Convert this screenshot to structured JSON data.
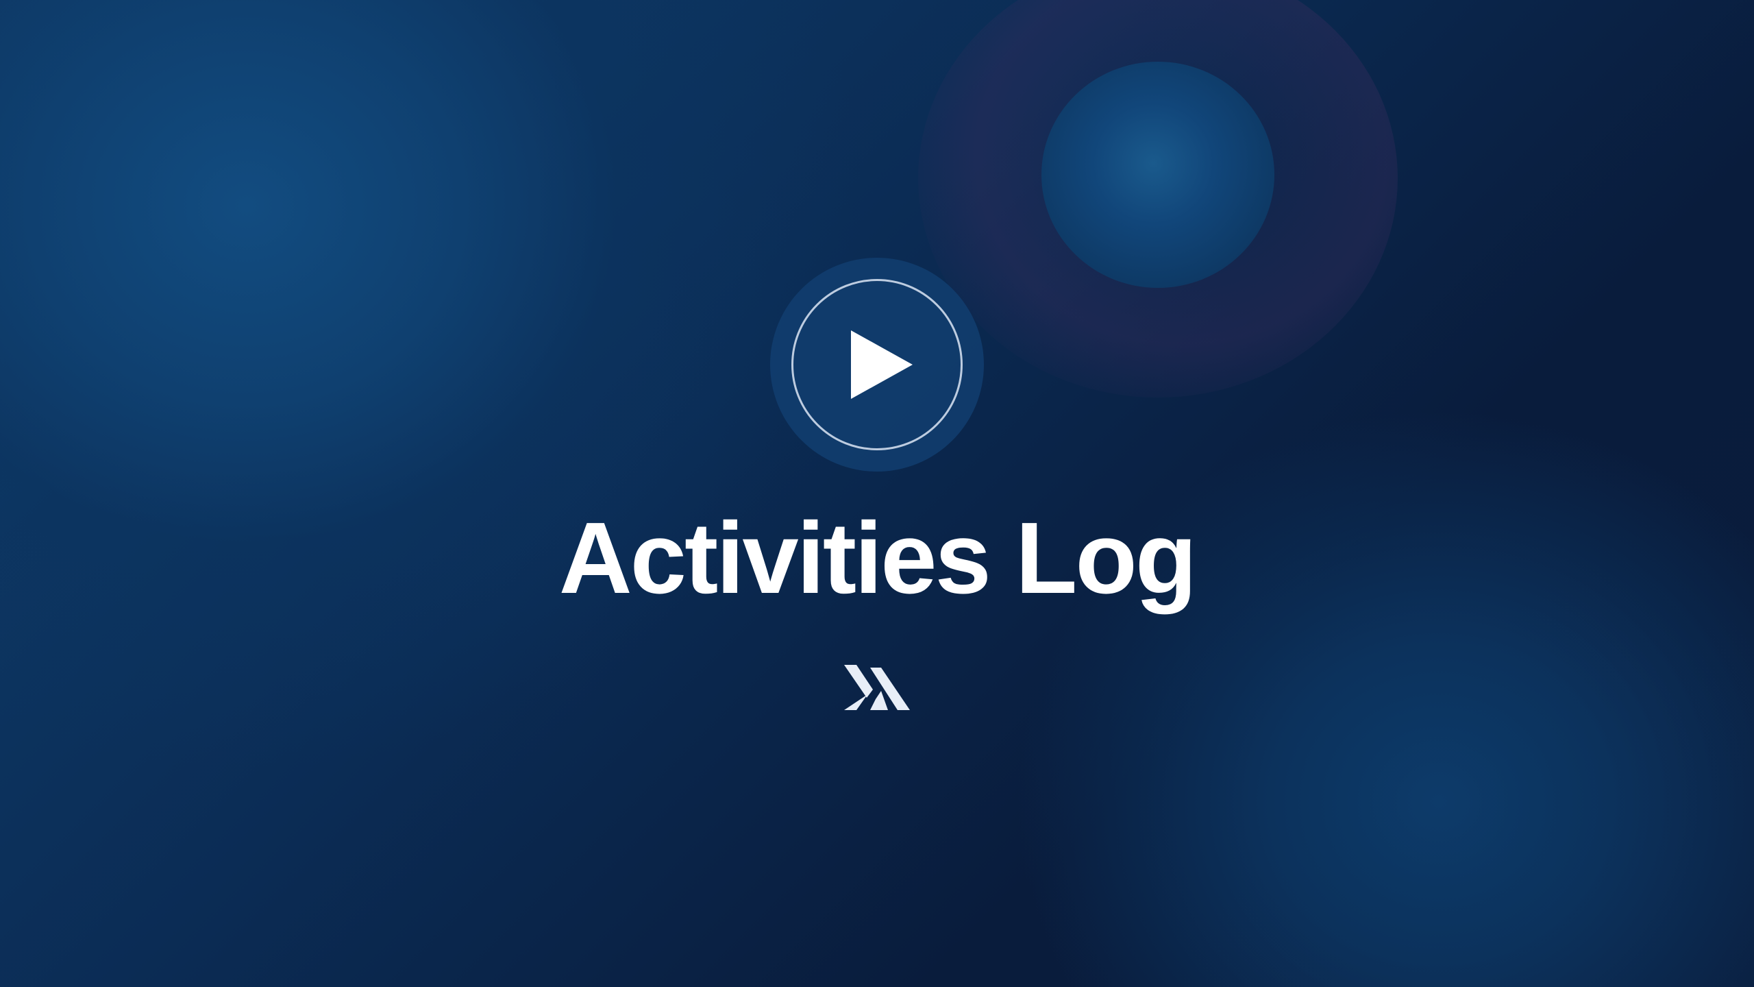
{
  "slide": {
    "title": "Activities Log"
  },
  "controls": {
    "play_icon": "play-icon",
    "logo_icon": "brand-logo-icon"
  },
  "colors": {
    "background_dark": "#0a1f40",
    "background_light": "#124c80",
    "text": "#ffffff",
    "play_circle": "#123e70"
  }
}
